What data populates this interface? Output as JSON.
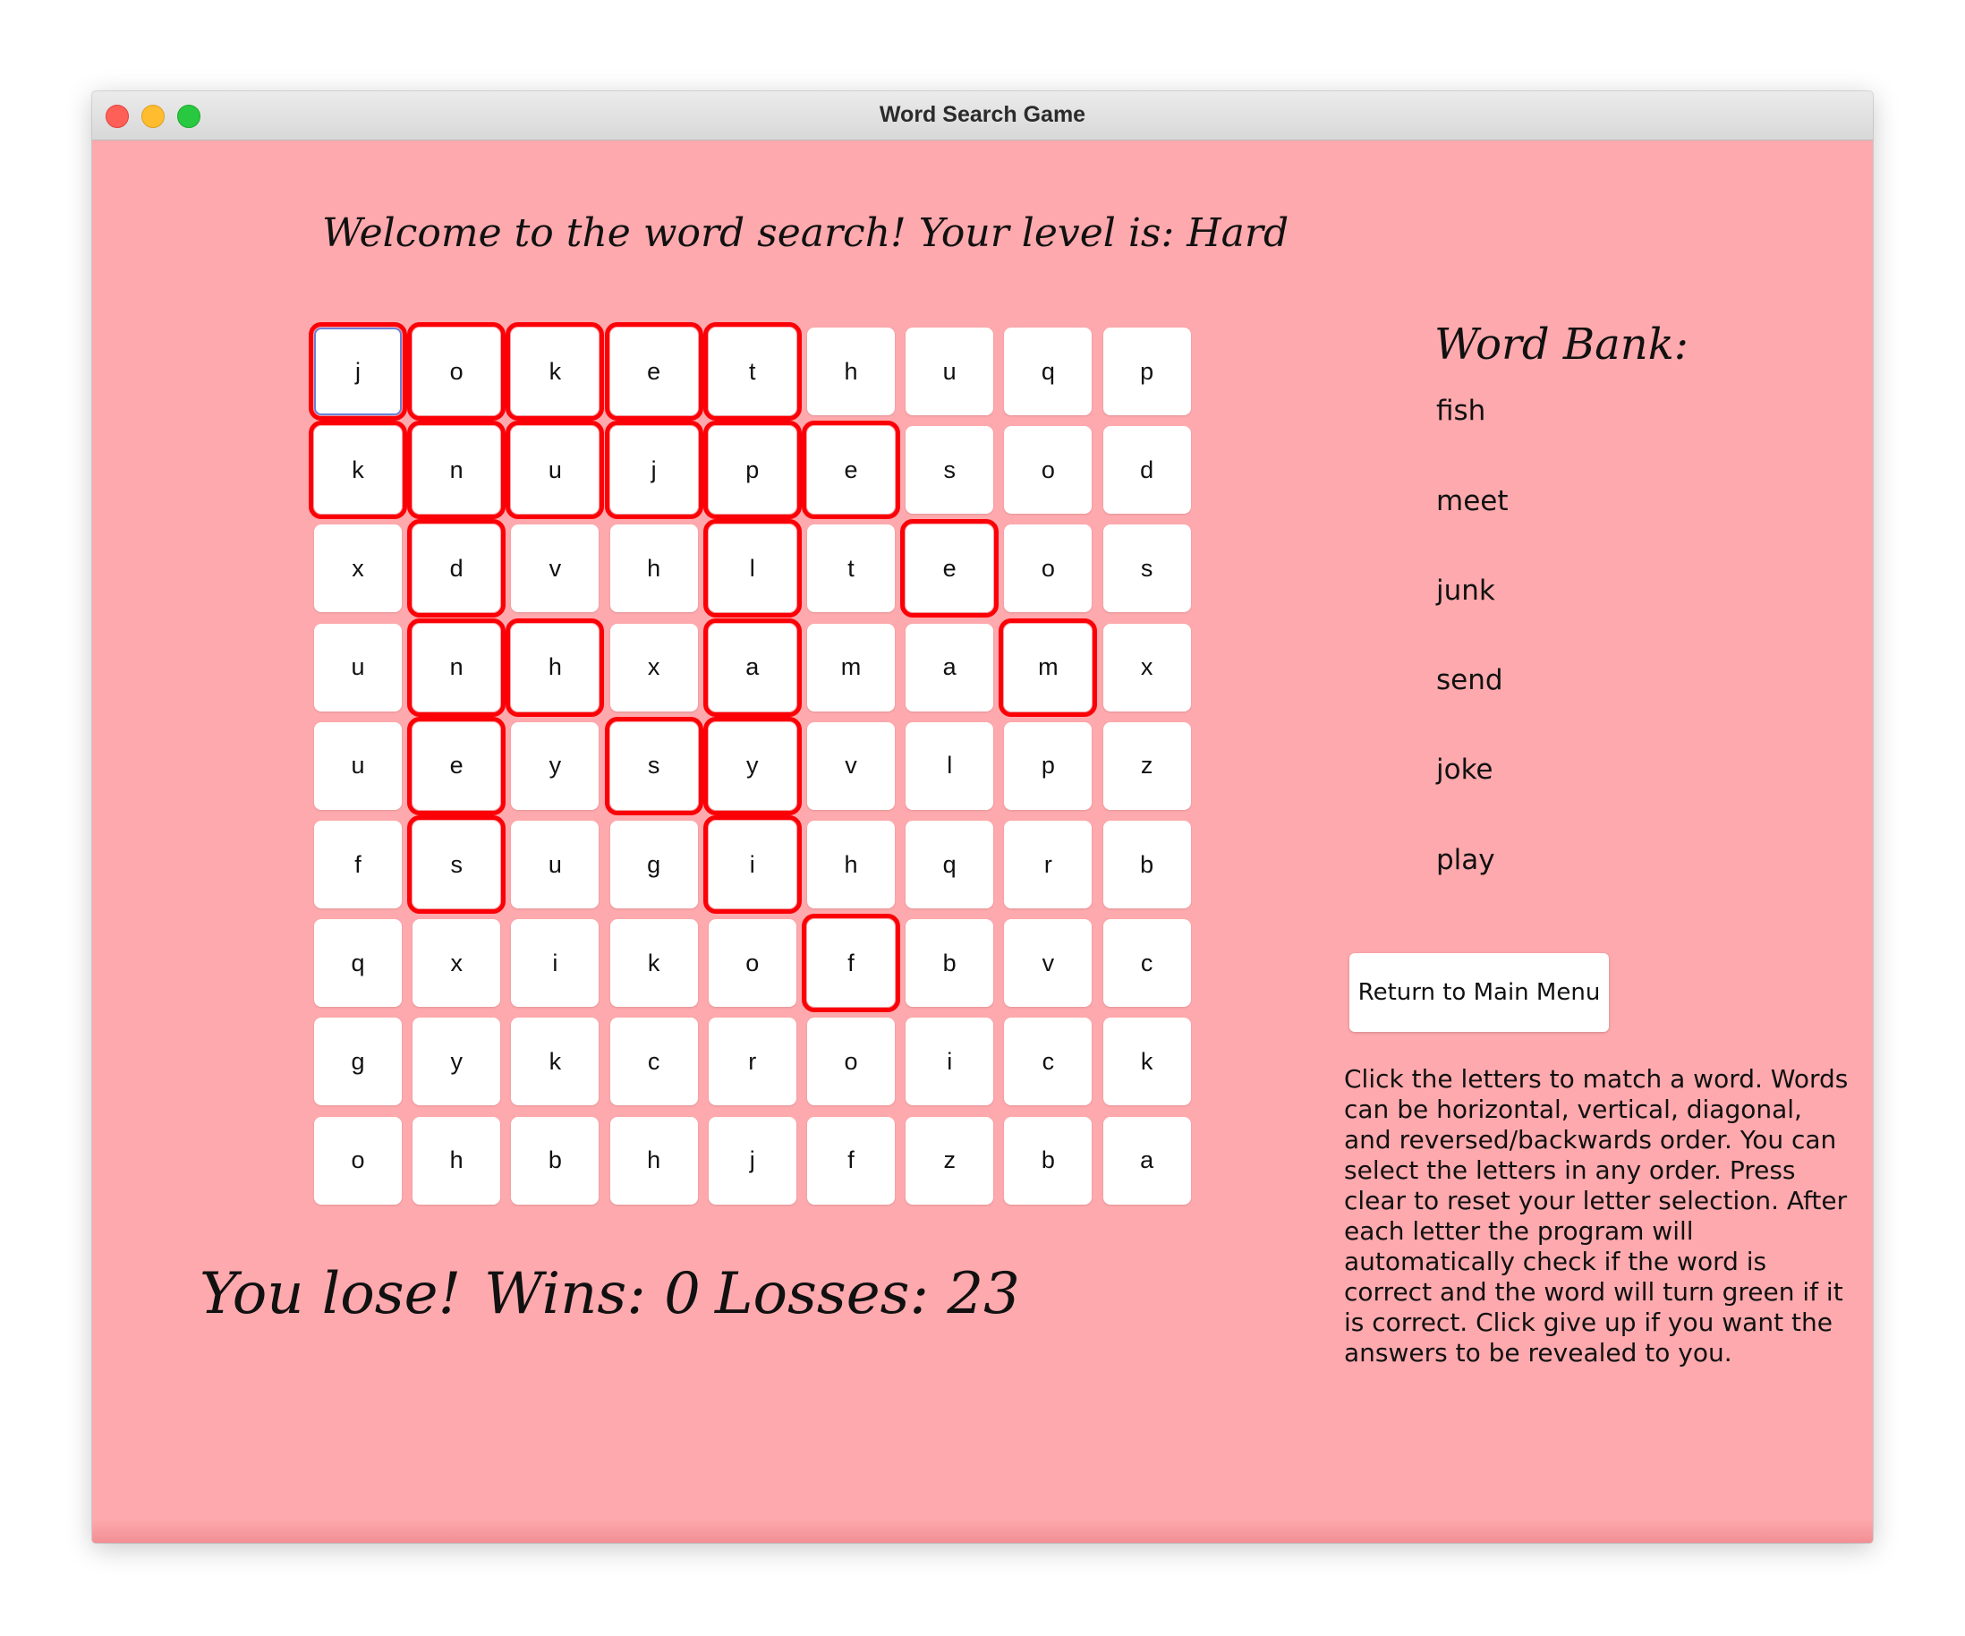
{
  "window": {
    "title": "Word Search Game"
  },
  "header": {
    "welcome": "Welcome to the word search! Your level is: Hard"
  },
  "grid": {
    "rows": [
      [
        "j",
        "o",
        "k",
        "e",
        "t",
        "h",
        "u",
        "q",
        "p"
      ],
      [
        "k",
        "n",
        "u",
        "j",
        "p",
        "e",
        "s",
        "o",
        "d"
      ],
      [
        "x",
        "d",
        "v",
        "h",
        "l",
        "t",
        "e",
        "o",
        "s"
      ],
      [
        "u",
        "n",
        "h",
        "x",
        "a",
        "m",
        "a",
        "m",
        "x"
      ],
      [
        "u",
        "e",
        "y",
        "s",
        "y",
        "v",
        "l",
        "p",
        "z"
      ],
      [
        "f",
        "s",
        "u",
        "g",
        "i",
        "h",
        "q",
        "r",
        "b"
      ],
      [
        "q",
        "x",
        "i",
        "k",
        "o",
        "f",
        "b",
        "v",
        "c"
      ],
      [
        "g",
        "y",
        "k",
        "c",
        "r",
        "o",
        "i",
        "c",
        "k"
      ],
      [
        "o",
        "h",
        "b",
        "h",
        "j",
        "f",
        "z",
        "b",
        "a"
      ]
    ],
    "highlighted": [
      [
        0,
        0
      ],
      [
        0,
        1
      ],
      [
        0,
        2
      ],
      [
        0,
        3
      ],
      [
        0,
        4
      ],
      [
        1,
        0
      ],
      [
        1,
        1
      ],
      [
        1,
        2
      ],
      [
        1,
        3
      ],
      [
        1,
        4
      ],
      [
        1,
        5
      ],
      [
        2,
        1
      ],
      [
        2,
        4
      ],
      [
        2,
        6
      ],
      [
        3,
        1
      ],
      [
        3,
        2
      ],
      [
        3,
        4
      ],
      [
        3,
        7
      ],
      [
        4,
        1
      ],
      [
        4,
        3
      ],
      [
        4,
        4
      ],
      [
        5,
        1
      ],
      [
        5,
        4
      ],
      [
        6,
        5
      ]
    ],
    "focused": [
      0,
      0
    ],
    "highlight_color": "#fb0007"
  },
  "word_bank": {
    "title": "Word Bank:",
    "words": [
      "fish",
      "meet",
      "junk",
      "send",
      "joke",
      "play"
    ]
  },
  "menu_button": {
    "label": "Return to Main Menu"
  },
  "instructions": "Click the letters to match a word. Words can be horizontal, vertical, diagonal, and reversed/backwards order. You can select the letters in any order. Press clear to reset your letter selection. After each letter the program will automatically check if the word is correct and the word will turn green if it is correct. Click give up if you want the answers to be revealed to you.",
  "status": {
    "result": "You lose!",
    "wins": "Wins: 0",
    "losses": "Losses: 23"
  },
  "colors": {
    "background": "#fea9ad",
    "tile": "#ffffff",
    "selection": "#fb0007"
  }
}
